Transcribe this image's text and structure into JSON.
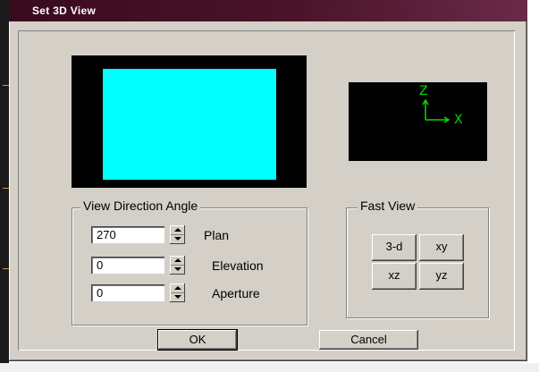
{
  "window": {
    "title": "Set 3D View"
  },
  "axes": {
    "z_label": "Z",
    "x_label": "X"
  },
  "view_direction": {
    "group_title": "View Direction Angle",
    "plan": {
      "value": "270",
      "label": "Plan"
    },
    "elevation": {
      "value": "0",
      "label": "Elevation"
    },
    "aperture": {
      "value": "0",
      "label": "Aperture"
    }
  },
  "fast_view": {
    "group_title": "Fast View",
    "buttons": {
      "b3d": "3-d",
      "xy": "xy",
      "xz": "xz",
      "yz": "yz"
    }
  },
  "footer": {
    "ok_label": "OK",
    "cancel_label": "Cancel"
  },
  "colors": {
    "preview_fill": "#00ffff",
    "axis_color": "#00dd00",
    "title_bar": "#3a0a1e"
  }
}
